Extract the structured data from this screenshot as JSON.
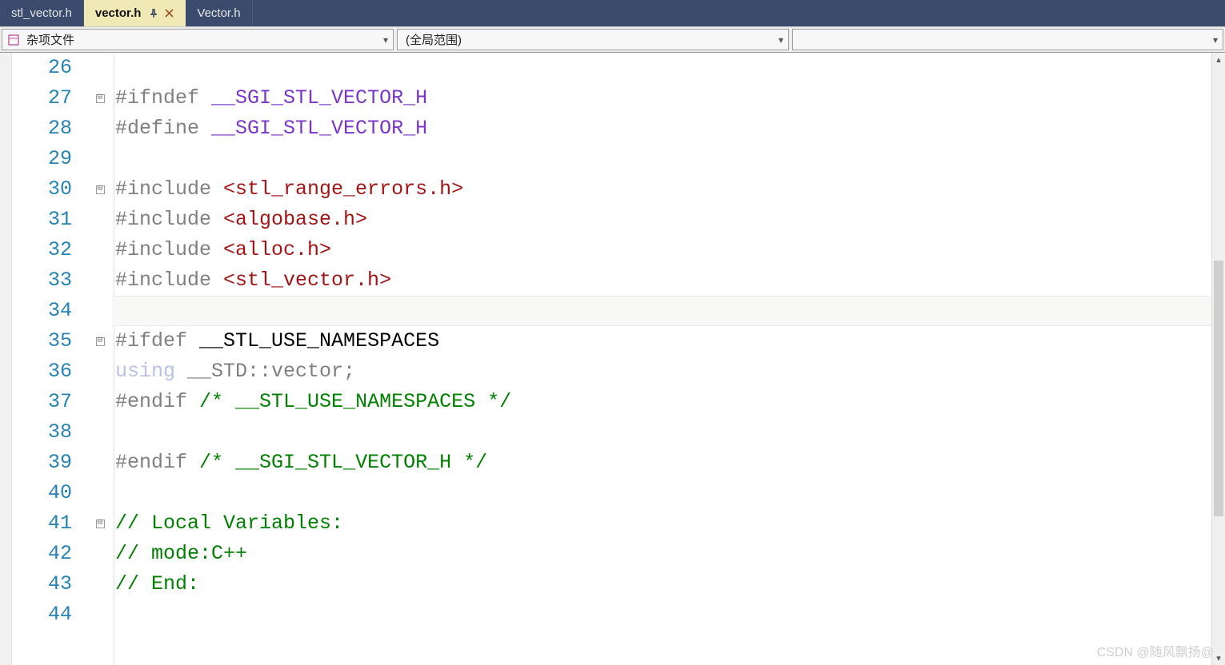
{
  "tabs": {
    "t0": "stl_vector.h",
    "t1": "vector.h",
    "t2": "Vector.h"
  },
  "dropdowns": {
    "d1": "杂项文件",
    "d2": "(全局范围)",
    "d3": ""
  },
  "gutter": [
    "26",
    "27",
    "28",
    "29",
    "30",
    "31",
    "32",
    "33",
    "34",
    "35",
    "36",
    "37",
    "38",
    "39",
    "40",
    "41",
    "42",
    "43",
    "44"
  ],
  "fold": {
    "27": "⊟",
    "30": "⊟",
    "35": "⊟",
    "41": "⊟"
  },
  "code": {
    "l27": {
      "pp": "#ifndef ",
      "def": "__SGI_STL_VECTOR_H"
    },
    "l28": {
      "pp": "#define ",
      "def": "__SGI_STL_VECTOR_H"
    },
    "l30": {
      "pp": "#include ",
      "inc": "<stl_range_errors.h>"
    },
    "l31": {
      "pp": "#include ",
      "inc": "<algobase.h>"
    },
    "l32": {
      "pp": "#include ",
      "inc": "<alloc.h>"
    },
    "l33": {
      "pp": "#include ",
      "inc": "<stl_vector.h>"
    },
    "l35": {
      "pp": "#ifdef ",
      "id": "__STL_USE_NAMESPACES"
    },
    "l36": {
      "kw": "using",
      "id": " __STD::vector;"
    },
    "l37": {
      "pp": "#endif ",
      "cm": "/* __STL_USE_NAMESPACES */"
    },
    "l39": {
      "pp": "#endif ",
      "cm": "/* __SGI_STL_VECTOR_H */"
    },
    "l41": {
      "cm": "// Local Variables:"
    },
    "l42": {
      "cm": "// mode:C++"
    },
    "l43": {
      "cm": "// End:"
    }
  },
  "watermark": "CSDN @随风飘扬@"
}
